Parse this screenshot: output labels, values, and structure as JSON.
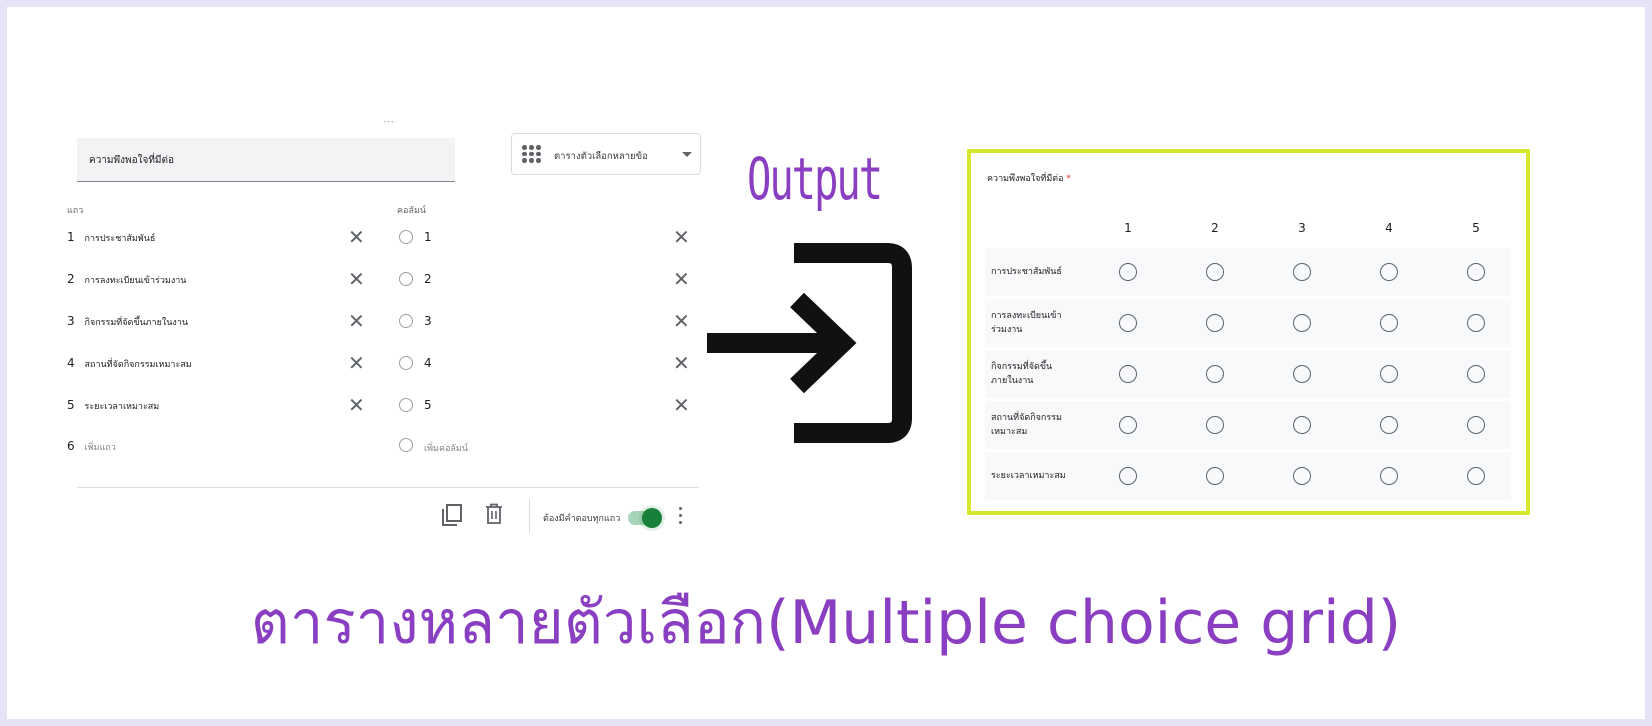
{
  "editor": {
    "question_title": "ความพึงพอใจที่มีต่อ",
    "question_type": "ตารางตัวเลือกหลายข้อ",
    "rows_header": "แถว",
    "columns_header": "คอลัมน์",
    "rows": [
      {
        "num": "1",
        "text": "การประชาสัมพันธ์"
      },
      {
        "num": "2",
        "text": "การลงทะเบียนเข้าร่วมงาน"
      },
      {
        "num": "3",
        "text": "กิจกรรมที่จัดขึ้นภายในงาน"
      },
      {
        "num": "4",
        "text": "สถานที่จัดกิจกรรมเหมาะสม"
      },
      {
        "num": "5",
        "text": "ระยะเวลาเหมาะสม"
      }
    ],
    "add_row": {
      "num": "6",
      "text": "เพิ่มแถว"
    },
    "columns": [
      "1",
      "2",
      "3",
      "4",
      "5"
    ],
    "add_column": "เพิ่มคอลัมน์",
    "require_label": "ต้องมีคำตอบทุกแถว",
    "require_enabled": true,
    "remove_symbol": "✕",
    "drag_handle": "⋯"
  },
  "output_label": "Output",
  "arrow_icon": "arrow-into-bracket-icon",
  "preview": {
    "question": "ความพึงพอใจที่มีต่อ",
    "required_mark": "*",
    "columns": [
      "1",
      "2",
      "3",
      "4",
      "5"
    ],
    "rows": [
      "การประชาสัมพันธ์",
      "การลงทะเบียนเข้าร่วมงาน",
      "กิจกรรมที่จัดขึ้นภายในงาน",
      "สถานที่จัดกิจกรรมเหมาะสม",
      "ระยะเวลาเหมาะสม"
    ]
  },
  "caption": "ตารางหลายตัวเลือก(Multiple choice grid)",
  "colors": {
    "background": "#e6e3f7",
    "accent_purple": "#8a3fc2",
    "highlight_border": "#d8e62e",
    "toggle_on": "#188038",
    "required": "#d93025"
  }
}
